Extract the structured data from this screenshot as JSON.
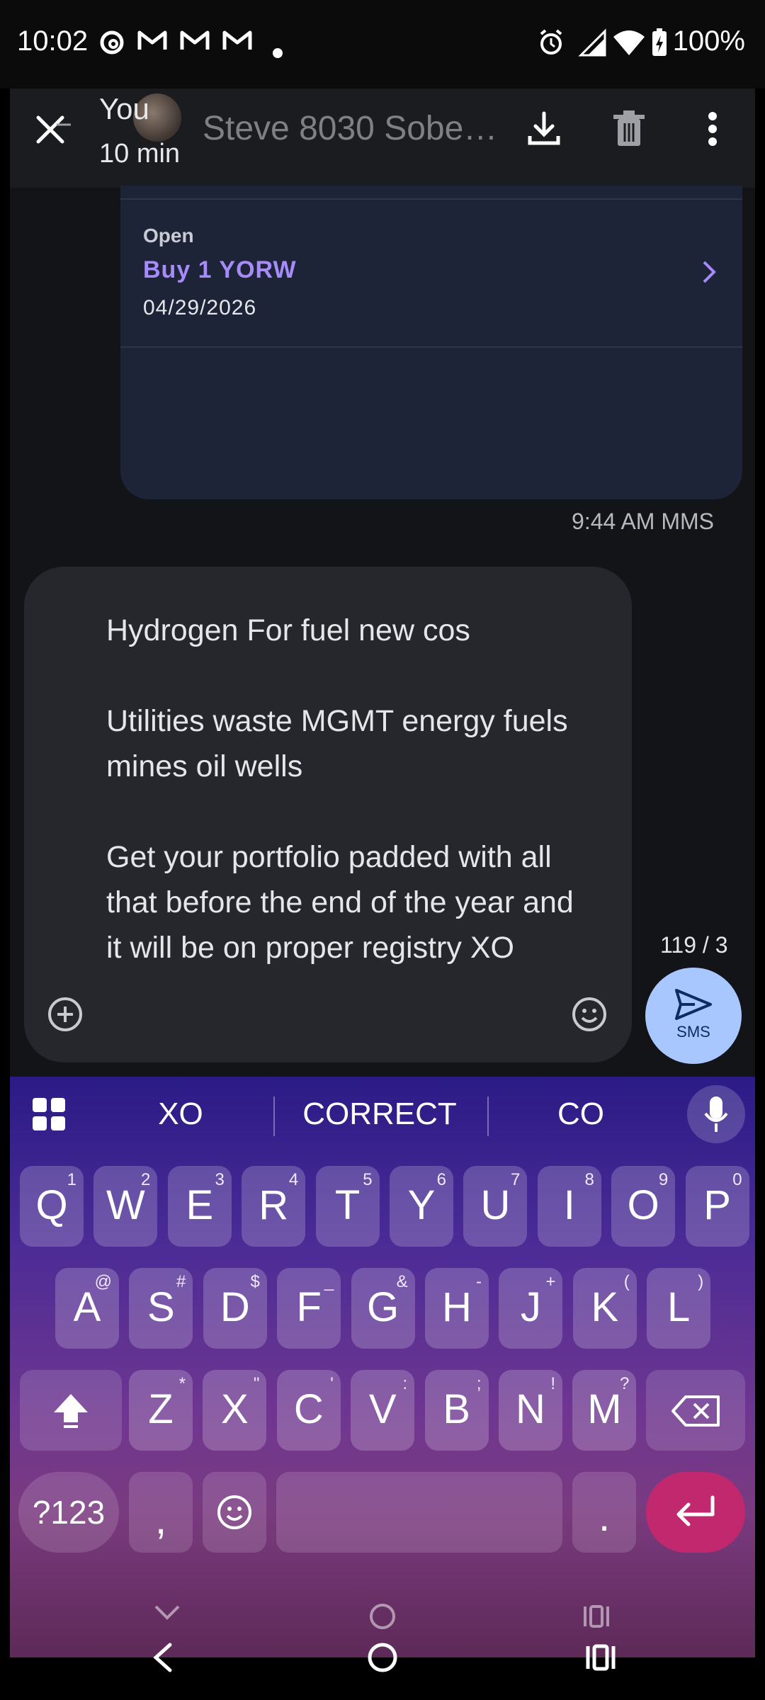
{
  "status_bar": {
    "time": "10:02",
    "battery_pct": "100%",
    "notification_icons": [
      "threads-icon",
      "gmail-icon",
      "gmail-icon",
      "gmail-icon",
      "dot-icon"
    ],
    "system_icons": [
      "alarm-icon",
      "signal-icon",
      "wifi-icon",
      "battery-charging-icon"
    ]
  },
  "header": {
    "you_label": "You",
    "time_ago": "10 min",
    "contact_name": "Steve 8030 Sobe…"
  },
  "card": {
    "status": "Open",
    "title": "Buy 1 YORW",
    "date": "04/29/2026"
  },
  "message_meta": "9:44 AM MMS",
  "compose": {
    "text": "Hydrogen For fuel new cos\n\nUtilities waste MGMT energy fuels mines oil wells\n\nGet your portfolio padded with all that before the end of the year and it will be on proper registry XO",
    "char_count": "119 / 3",
    "send_label": "SMS"
  },
  "keyboard": {
    "suggestions": [
      "XO",
      "CORRECT",
      "CO"
    ],
    "row1": [
      {
        "k": "Q",
        "h": "1"
      },
      {
        "k": "W",
        "h": "2"
      },
      {
        "k": "E",
        "h": "3"
      },
      {
        "k": "R",
        "h": "4"
      },
      {
        "k": "T",
        "h": "5"
      },
      {
        "k": "Y",
        "h": "6"
      },
      {
        "k": "U",
        "h": "7"
      },
      {
        "k": "I",
        "h": "8"
      },
      {
        "k": "O",
        "h": "9"
      },
      {
        "k": "P",
        "h": "0"
      }
    ],
    "row2": [
      {
        "k": "A",
        "h": "@"
      },
      {
        "k": "S",
        "h": "#"
      },
      {
        "k": "D",
        "h": "$"
      },
      {
        "k": "F",
        "h": "_"
      },
      {
        "k": "G",
        "h": "&"
      },
      {
        "k": "H",
        "h": "-"
      },
      {
        "k": "J",
        "h": "+"
      },
      {
        "k": "K",
        "h": "("
      },
      {
        "k": "L",
        "h": ")"
      }
    ],
    "row3": [
      {
        "k": "Z",
        "h": "*"
      },
      {
        "k": "X",
        "h": "\""
      },
      {
        "k": "C",
        "h": "'"
      },
      {
        "k": "V",
        "h": ":"
      },
      {
        "k": "B",
        "h": ";"
      },
      {
        "k": "N",
        "h": "!"
      },
      {
        "k": "M",
        "h": "?"
      }
    ],
    "symbols_key": "?123",
    "comma_key": ",",
    "period_key": "."
  },
  "colors": {
    "accent_purple": "#a78bfa",
    "send_button": "#a9c7ff",
    "enter_key": "#c2286e"
  }
}
